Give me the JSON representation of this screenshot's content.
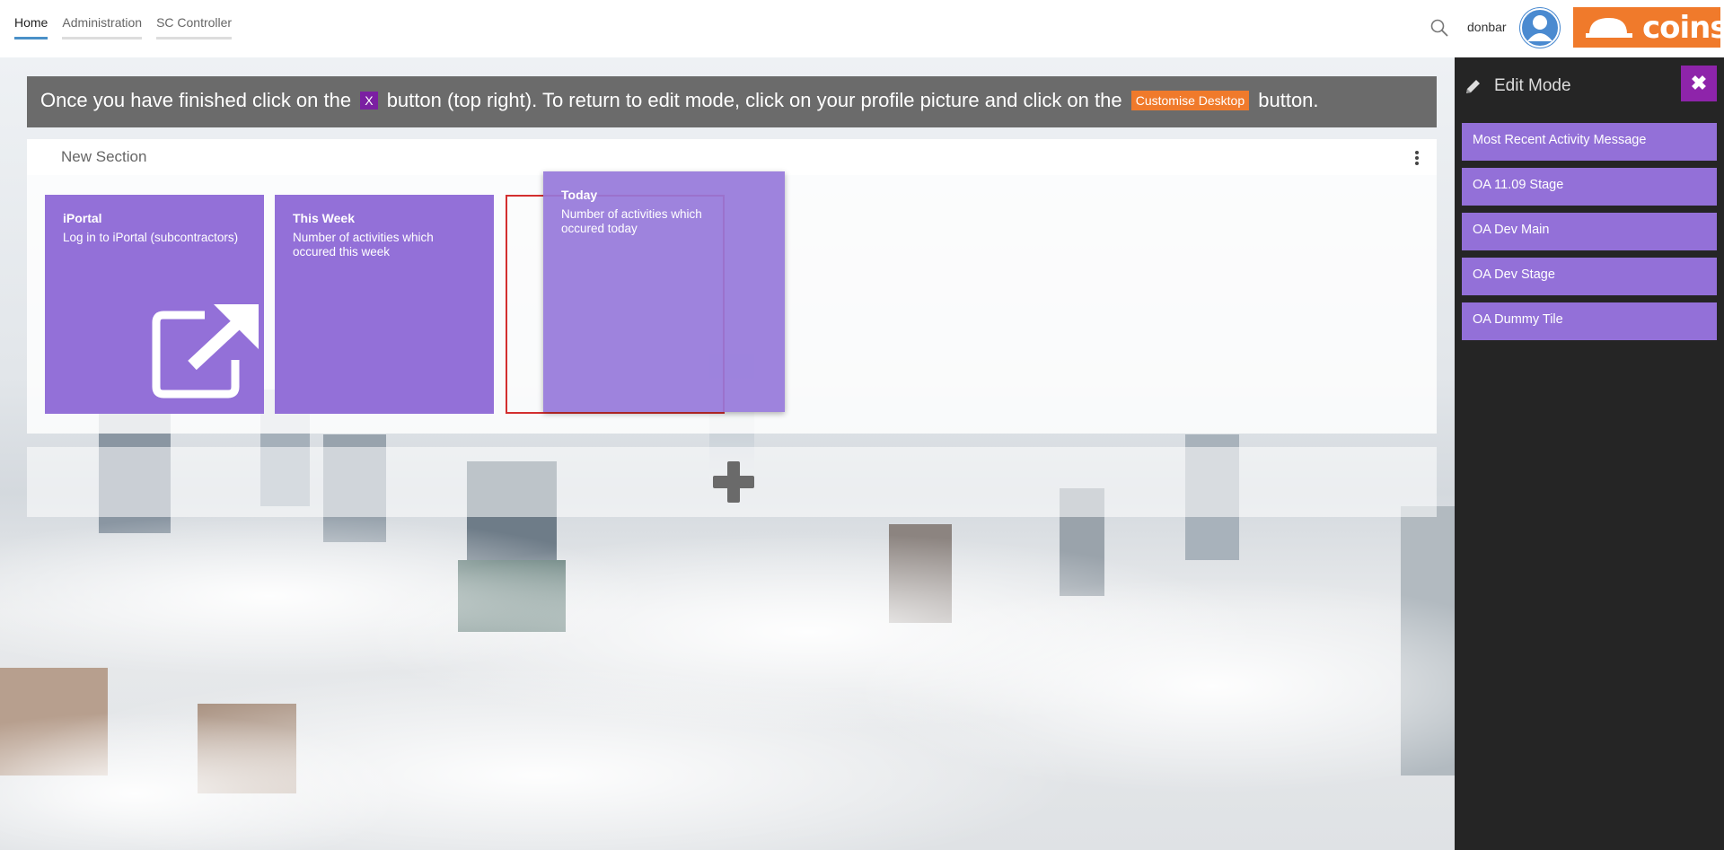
{
  "nav": {
    "tabs": [
      {
        "label": "Home",
        "active": true
      },
      {
        "label": "Administration",
        "active": false
      },
      {
        "label": "SC Controller",
        "active": false
      }
    ],
    "username": "donbar",
    "logo_text": "coins"
  },
  "banner": {
    "text_before": "Once you have finished click on the",
    "x_badge": "X",
    "text_middle": "button (top right). To return to edit mode, click on your profile picture and click on the",
    "customise_badge": "Customise Desktop",
    "text_after": "button."
  },
  "section": {
    "title": "New Section",
    "tiles": [
      {
        "title": "iPortal",
        "description": "Log in to iPortal (subcontractors)",
        "icon": "external-link-icon"
      },
      {
        "title": "This Week",
        "description": "Number of activities which occured this week"
      },
      {
        "title": "Today",
        "description": "Number of activities which occured today"
      }
    ]
  },
  "panel": {
    "title": "Edit Mode",
    "close_label": "✖",
    "items": [
      {
        "label": "Most Recent Activity Message"
      },
      {
        "label": "OA 11.09 Stage"
      },
      {
        "label": "OA Dev Main"
      },
      {
        "label": "OA Dev Stage"
      },
      {
        "label": "OA Dummy Tile"
      }
    ]
  },
  "colors": {
    "tile": "#9370d8",
    "accent_orange": "#f07a2b",
    "accent_purple": "#8e24aa",
    "panel_bg": "#252525",
    "banner_bg": "#6b6b6b"
  }
}
